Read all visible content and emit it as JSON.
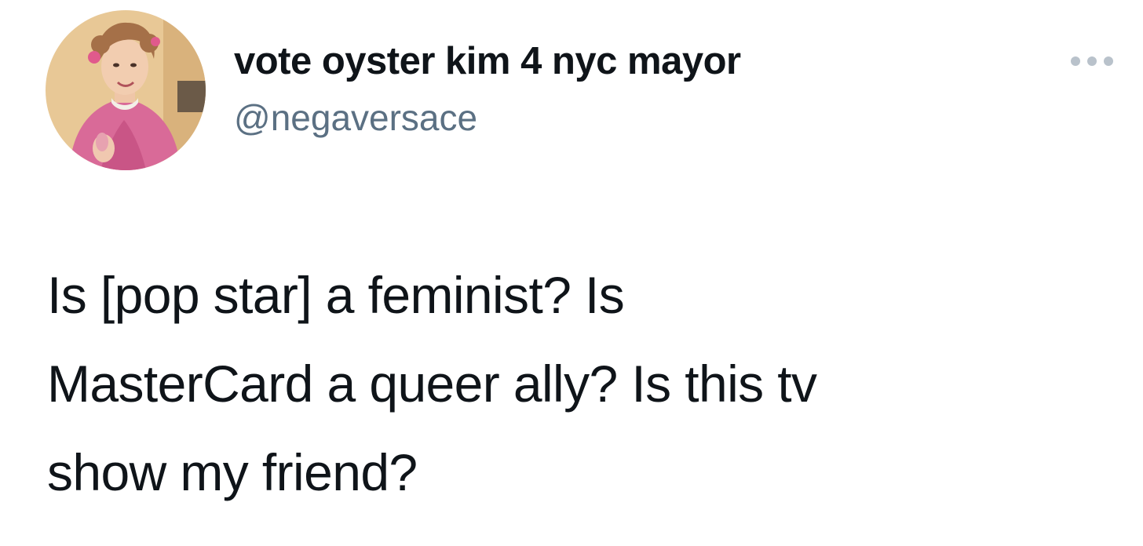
{
  "tweet": {
    "author": {
      "display_name": "vote oyster kim 4 nyc mayor",
      "handle": "@negaversace",
      "avatar_icon": "profile-photo"
    },
    "menu_icon": "more-horizontal-icon",
    "text": "Is [pop star] a feminist? Is\nMasterCard a queer ally? Is this tv\nshow my friend?"
  },
  "colors": {
    "text_primary": "#0f1419",
    "text_secondary": "#5b7083",
    "icon_muted": "#b9c2cb",
    "background": "#ffffff"
  }
}
